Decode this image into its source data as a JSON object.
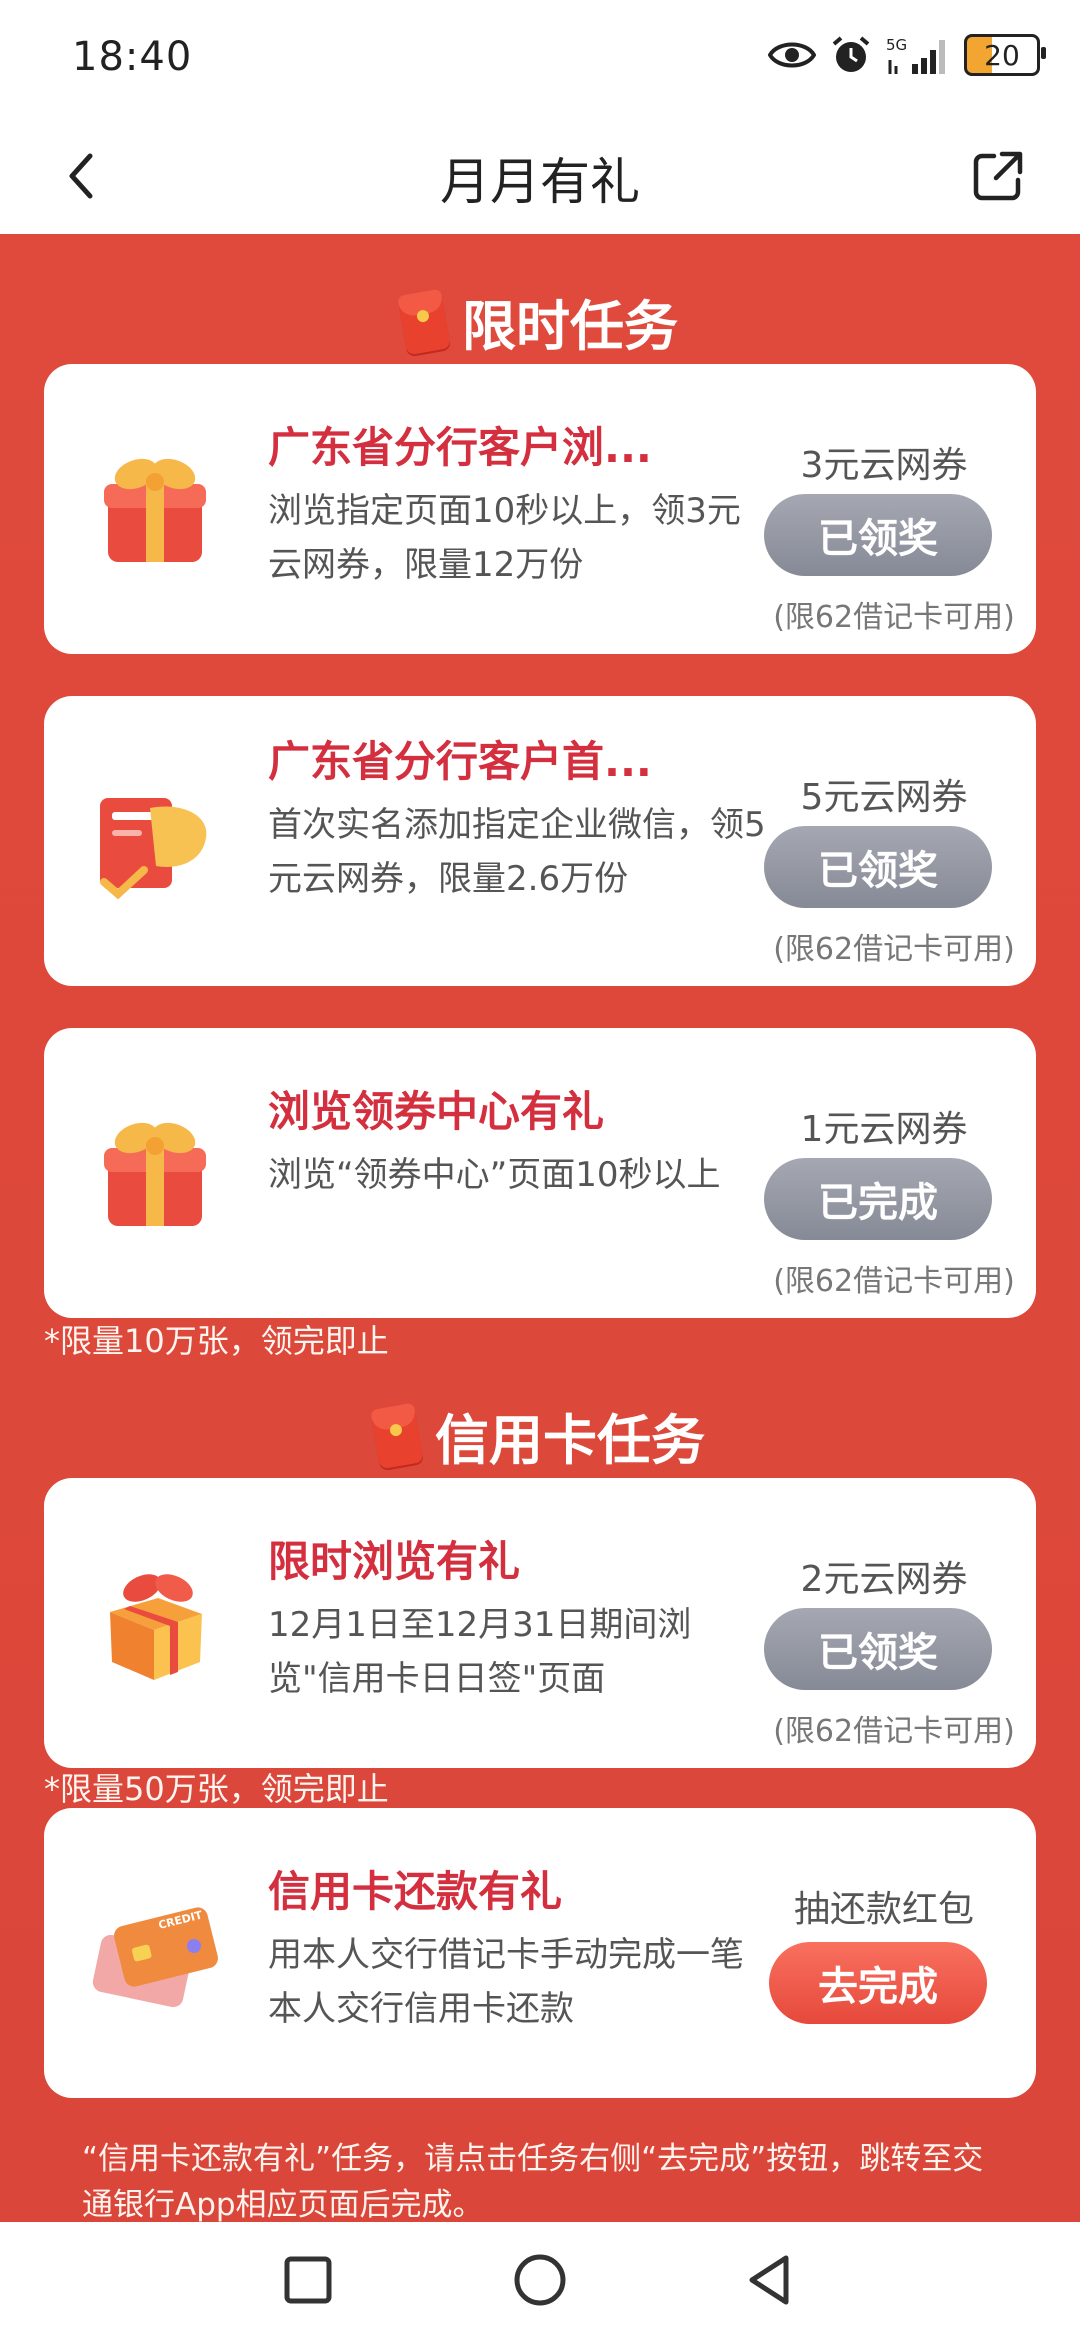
{
  "status": {
    "time": "18:40",
    "battery": "20",
    "network": "5G"
  },
  "header": {
    "title": "月月有礼",
    "back": "back",
    "share": "share"
  },
  "sections": [
    {
      "title": "限时任务"
    },
    {
      "title": "信用卡任务"
    }
  ],
  "tasks": [
    {
      "title": "广东省分行客户浏...",
      "desc": "浏览指定页面10秒以上，领3元云网券，限量12万份",
      "reward": "3元云网券",
      "button": "已领奖",
      "note": "(限62借记卡可用)"
    },
    {
      "title": "广东省分行客户首...",
      "desc": "首次实名添加指定企业微信，领5元云网券，限量2.6万份",
      "reward": "5元云网券",
      "button": "已领奖",
      "note": "(限62借记卡可用)"
    },
    {
      "title": "浏览领券中心有礼",
      "desc": "浏览“领券中心”页面10秒以上",
      "reward": "1元云网券",
      "button": "已完成",
      "note": "(限62借记卡可用)"
    },
    {
      "title": "限时浏览有礼",
      "desc": "12月1日至12月31日期间浏览\"信用卡日日签\"页面",
      "reward": "2元云网券",
      "button": "已领奖",
      "note": "(限62借记卡可用)"
    },
    {
      "title": "信用卡还款有礼",
      "desc": "用本人交行借记卡手动完成一笔本人交行信用卡还款",
      "reward": "抽还款红包",
      "button": "去完成"
    }
  ],
  "footnotes": [
    "*限量10万张，领完即止",
    "*限量50万张，领完即止"
  ],
  "bottom_text": "“信用卡还款有礼”任务，请点击任务右侧“去完成”按钮，跳转至交通银行App相应页面后完成。",
  "colors": {
    "background": "#d9473a",
    "title_red": "#d42f3e",
    "done_button": "#8e919c",
    "go_button": "#e6493c"
  },
  "icons": [
    "gift-box-icon",
    "card-document-icon",
    "gift-box-icon",
    "gift-box-3d-icon",
    "credit-card-icon"
  ]
}
